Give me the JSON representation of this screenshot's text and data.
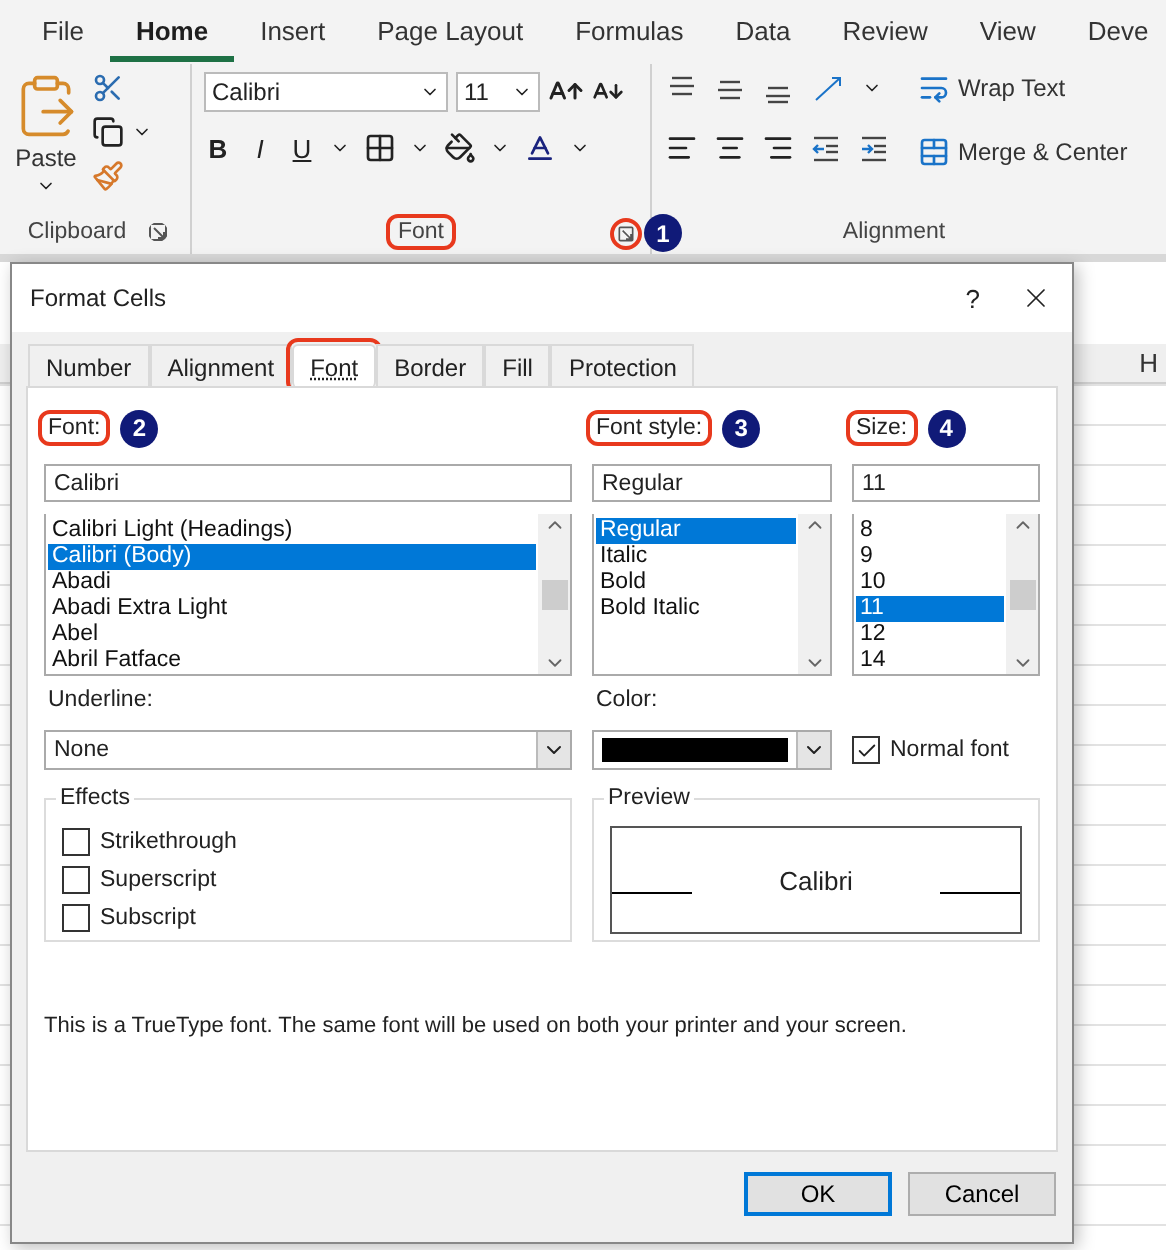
{
  "menu_tabs": [
    {
      "label": "File",
      "selected": false
    },
    {
      "label": "Home",
      "selected": true
    },
    {
      "label": "Insert",
      "selected": false
    },
    {
      "label": "Page Layout",
      "selected": false
    },
    {
      "label": "Formulas",
      "selected": false
    },
    {
      "label": "Data",
      "selected": false
    },
    {
      "label": "Review",
      "selected": false
    },
    {
      "label": "View",
      "selected": false
    },
    {
      "label": "Deve",
      "selected": false
    }
  ],
  "ribbon": {
    "clipboard": {
      "paste_label": "Paste",
      "label": "Clipboard"
    },
    "font": {
      "font_name": "Calibri",
      "font_size": "11",
      "format_buttons": [
        "B",
        "I",
        "U"
      ],
      "label": "Font",
      "label_highlighted": true,
      "launcher_highlighted": true,
      "callout": "1"
    },
    "alignment": {
      "wrap_text": "Wrap Text",
      "merge_center": "Merge & Center",
      "label": "Alignment"
    }
  },
  "sheet": {
    "column_header": "H"
  },
  "dialog": {
    "title": "Format Cells",
    "help": "?",
    "tabs": [
      {
        "label": "Number",
        "selected": false,
        "highlighted": false
      },
      {
        "label": "Alignment",
        "selected": false,
        "highlighted": false
      },
      {
        "label": "Font",
        "selected": true,
        "highlighted": true
      },
      {
        "label": "Border",
        "selected": false,
        "highlighted": false
      },
      {
        "label": "Fill",
        "selected": false,
        "highlighted": false
      },
      {
        "label": "Protection",
        "selected": false,
        "highlighted": false
      }
    ],
    "columns": [
      {
        "label": "Font:",
        "highlighted": true,
        "callout": "2",
        "value": "Calibri",
        "items": [
          {
            "label": "Calibri Light (Headings)",
            "selected": false
          },
          {
            "label": "Calibri (Body)",
            "selected": true
          },
          {
            "label": "Abadi",
            "selected": false
          },
          {
            "label": "Abadi Extra Light",
            "selected": false
          },
          {
            "label": "Abel",
            "selected": false
          },
          {
            "label": "Abril Fatface",
            "selected": false
          }
        ]
      },
      {
        "label": "Font style:",
        "highlighted": true,
        "callout": "3",
        "value": "Regular",
        "items": [
          {
            "label": "Regular",
            "selected": true
          },
          {
            "label": "Italic",
            "selected": false
          },
          {
            "label": "Bold",
            "selected": false
          },
          {
            "label": "Bold Italic",
            "selected": false
          }
        ]
      },
      {
        "label": "Size:",
        "highlighted": true,
        "callout": "4",
        "value": "11",
        "items": [
          {
            "label": "8",
            "selected": false
          },
          {
            "label": "9",
            "selected": false
          },
          {
            "label": "10",
            "selected": false
          },
          {
            "label": "11",
            "selected": true
          },
          {
            "label": "12",
            "selected": false
          },
          {
            "label": "14",
            "selected": false
          }
        ]
      }
    ],
    "underline": {
      "label": "Underline:",
      "value": "None"
    },
    "color": {
      "label": "Color:",
      "color": "#000000"
    },
    "normal_font": {
      "label": "Normal font",
      "checked": true
    },
    "effects": {
      "title": "Effects",
      "items": [
        {
          "label": "Strikethrough",
          "checked": false
        },
        {
          "label": "Superscript",
          "checked": false
        },
        {
          "label": "Subscript",
          "checked": false
        }
      ]
    },
    "preview": {
      "title": "Preview",
      "sample": "Calibri"
    },
    "info": "This is a TrueType font.  The same font will be used on both your printer and your screen.",
    "buttons": [
      {
        "label": "OK",
        "default": true
      },
      {
        "label": "Cancel",
        "default": false
      }
    ]
  }
}
